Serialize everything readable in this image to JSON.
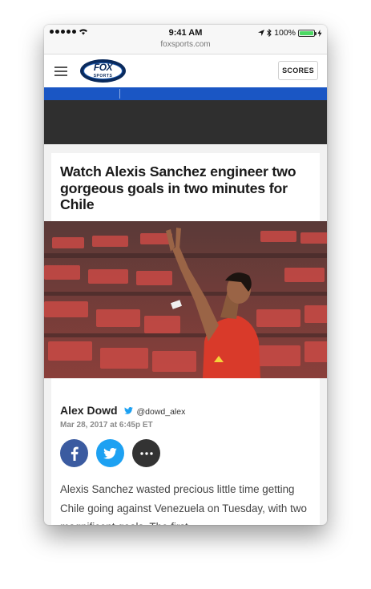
{
  "status_bar": {
    "time": "9:41 AM",
    "battery": "100%"
  },
  "url": "foxsports.com",
  "header": {
    "logo_text": "FOX",
    "logo_subtext": "SPORTS",
    "scores_label": "SCORES"
  },
  "banner_text": "",
  "article": {
    "headline": "Watch Alexis Sanchez engineer two gorgeous goals in two minutes for Chile",
    "author": "Alex Dowd",
    "twitter_handle": "@dowd_alex",
    "date": "Mar 28, 2017 at 6:45p ET",
    "body": "Alexis Sanchez wasted precious little time getting Chile going against Venezuela on Tuesday, with two magnificent goals. The first"
  },
  "share": {
    "facebook_icon": "f",
    "twitter_icon": "bird",
    "more_icon": "•••"
  },
  "colors": {
    "blue_band": "#1a56c4",
    "dark_band": "#2f2f2f",
    "facebook": "#3b5ba0",
    "twitter": "#1da1f2"
  }
}
